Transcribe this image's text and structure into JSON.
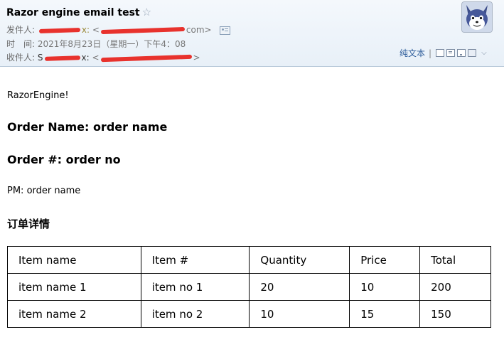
{
  "email": {
    "subject": "Razor engine email test",
    "from_label": "发件人:",
    "from_name_fragment": "x:",
    "from_addr_open": "<",
    "from_addr_close": "com>",
    "time_label": "时　间:",
    "time_value": "2021年8月23日（星期一）下午4：08",
    "to_label": "收件人:",
    "to_name_fragment": "S",
    "to_name_fragment2": "x:",
    "to_addr_open": "<",
    "to_addr_close": ">"
  },
  "toolbar": {
    "plain_text": "纯文本",
    "separator": "|"
  },
  "body": {
    "intro": "RazorEngine!",
    "order_name_heading": "Order Name: order name",
    "order_no_heading": "Order #: order no",
    "pm_line": "PM: order name",
    "details_heading": "订单详情"
  },
  "table": {
    "headers": [
      "Item name",
      "Item #",
      "Quantity",
      "Price",
      "Total"
    ],
    "rows": [
      [
        "item name 1",
        "item no 1",
        "20",
        "10",
        "200"
      ],
      [
        "item name 2",
        "item no 2",
        "10",
        "15",
        "150"
      ]
    ]
  },
  "colors": {
    "redaction": "#e8322d",
    "link": "#2e5d9a",
    "header_bg": "#e8f0f8"
  },
  "icons": [
    "star-icon",
    "contact-card-icon",
    "avatar-fox",
    "new-window-icon",
    "print-preview-icon",
    "download-icon",
    "print-icon",
    "more-chevron-icon"
  ]
}
